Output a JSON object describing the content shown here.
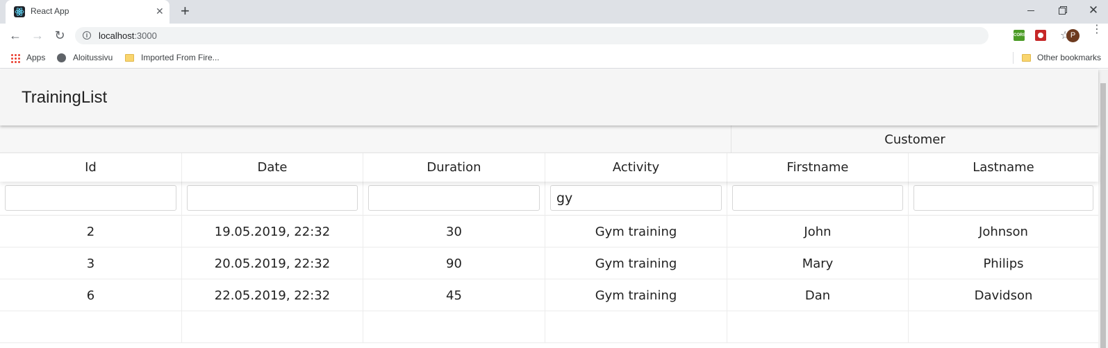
{
  "browser": {
    "tab_title": "React App",
    "tab_close": "✕",
    "new_tab": "+",
    "url_host": "localhost",
    "url_port": ":3000",
    "bookmarks": {
      "apps": "Apps",
      "aloitussivu": "Aloitussivu",
      "imported": "Imported From Fire...",
      "other": "Other bookmarks"
    },
    "extensions": {
      "cors_label": "CORS"
    },
    "profile_initial": "P"
  },
  "app": {
    "title": "TrainingList"
  },
  "table": {
    "group_header": "Customer",
    "columns": [
      "Id",
      "Date",
      "Duration",
      "Activity",
      "Firstname",
      "Lastname"
    ],
    "filters": [
      "",
      "",
      "",
      "gy",
      "",
      ""
    ],
    "rows": [
      [
        "2",
        "19.05.2019, 22:32",
        "30",
        "Gym training",
        "John",
        "Johnson"
      ],
      [
        "3",
        "20.05.2019, 22:32",
        "90",
        "Gym training",
        "Mary",
        "Philips"
      ],
      [
        "6",
        "22.05.2019, 22:32",
        "45",
        "Gym training",
        "Dan",
        "Davidson"
      ]
    ]
  },
  "colors": {
    "header_bg": "#f5f5f5",
    "tabstrip_bg": "#dee1e6",
    "text": "#222222"
  }
}
